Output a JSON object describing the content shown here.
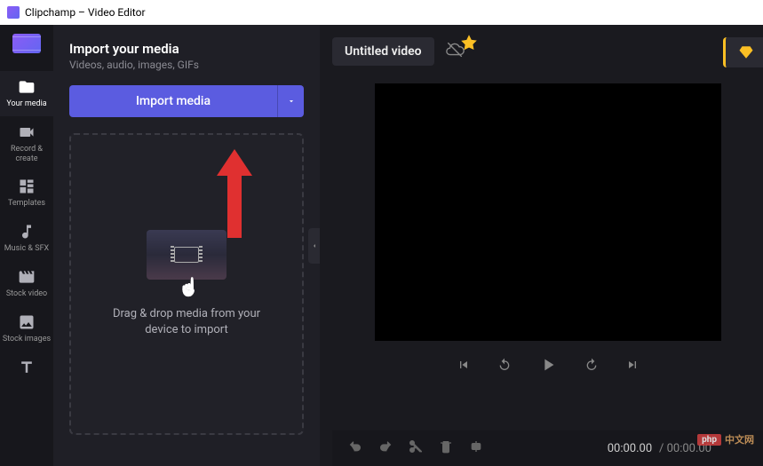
{
  "window": {
    "title": "Clipchamp – Video Editor"
  },
  "sidebar": {
    "items": [
      {
        "label": "Your media",
        "icon": "folder"
      },
      {
        "label": "Record & create",
        "icon": "camera"
      },
      {
        "label": "Templates",
        "icon": "templates"
      },
      {
        "label": "Music & SFX",
        "icon": "music"
      },
      {
        "label": "Stock video",
        "icon": "film"
      },
      {
        "label": "Stock images",
        "icon": "image"
      },
      {
        "label": "",
        "icon": "text"
      }
    ]
  },
  "media_panel": {
    "title": "Import your media",
    "subtitle": "Videos, audio, images, GIFs",
    "import_button": "Import media",
    "drop_text": "Drag & drop media from your device to import"
  },
  "editor": {
    "video_title": "Untitled video",
    "timecode_current": "00:00.00",
    "timecode_total": "00:00.00"
  },
  "watermark": {
    "badge": "php",
    "text": "中文网"
  }
}
